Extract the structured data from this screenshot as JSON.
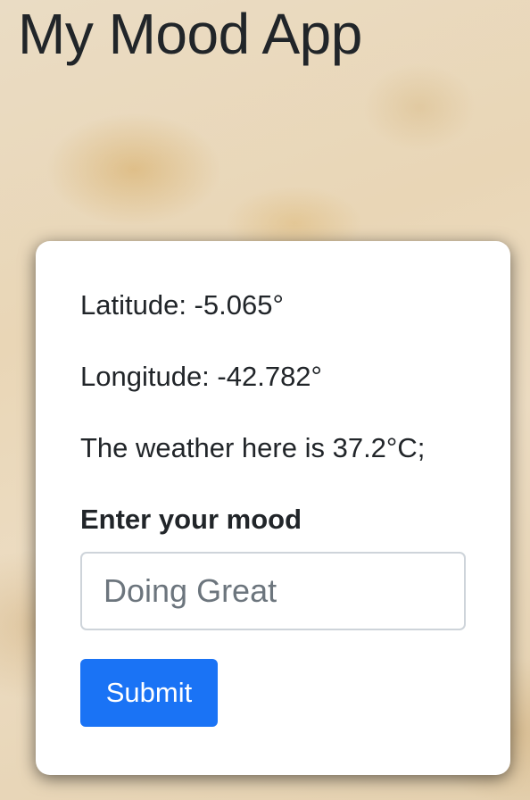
{
  "app": {
    "title": "My Mood App"
  },
  "location": {
    "latitude_label": "Latitude: -5.065°",
    "longitude_label": "Longitude: -42.782°",
    "weather_text": "The weather here is 37.2°C;"
  },
  "form": {
    "mood_label": "Enter your mood",
    "mood_placeholder": "Doing Great",
    "submit_label": "Submit"
  },
  "colors": {
    "accent": "#1a73f5",
    "text": "#212529",
    "card_background": "#ffffff"
  }
}
